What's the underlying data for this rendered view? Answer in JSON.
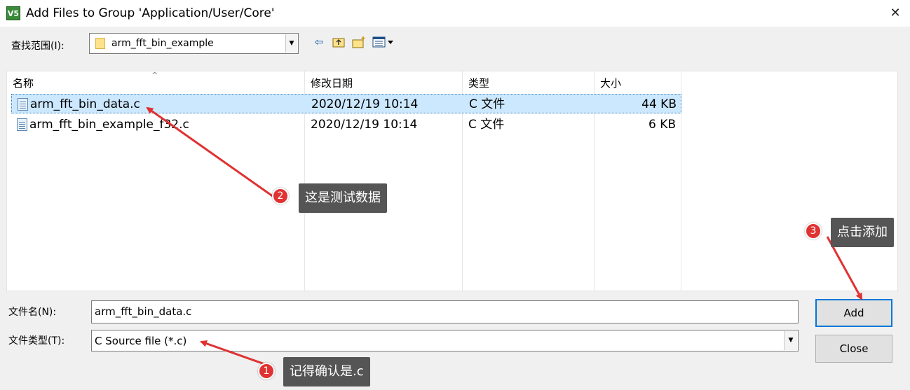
{
  "window": {
    "title": "Add Files to Group 'Application/User/Core'",
    "close_glyph": "✕",
    "app_icon_text": "V5"
  },
  "look_in": {
    "label": "查找范围(I):",
    "value": "arm_fft_bin_example"
  },
  "toolbar": {
    "icons": [
      "back-icon",
      "up-folder-icon",
      "new-folder-icon",
      "view-menu-icon"
    ]
  },
  "file_list": {
    "columns": [
      "名称",
      "修改日期",
      "类型",
      "大小"
    ],
    "rows": [
      {
        "name": "arm_fft_bin_data.c",
        "modified": "2020/12/19 10:14",
        "type": "C 文件",
        "size": "44 KB",
        "selected": true
      },
      {
        "name": "arm_fft_bin_example_f32.c",
        "modified": "2020/12/19 10:14",
        "type": "C 文件",
        "size": "6 KB",
        "selected": false
      }
    ]
  },
  "filename": {
    "label": "文件名(N):",
    "value": "arm_fft_bin_data.c"
  },
  "filetype": {
    "label": "文件类型(T):",
    "value": "C Source file (*.c)"
  },
  "buttons": {
    "add": "Add",
    "close": "Close"
  },
  "annotations": [
    {
      "number": "1",
      "text": "记得确认是.c"
    },
    {
      "number": "2",
      "text": "这是测试数据"
    },
    {
      "number": "3",
      "text": "点击添加"
    }
  ],
  "colors": {
    "selection": "#cce8ff",
    "annotation_red": "#e03232",
    "callout_bg": "#555555",
    "default_button_border": "#0078d7"
  }
}
